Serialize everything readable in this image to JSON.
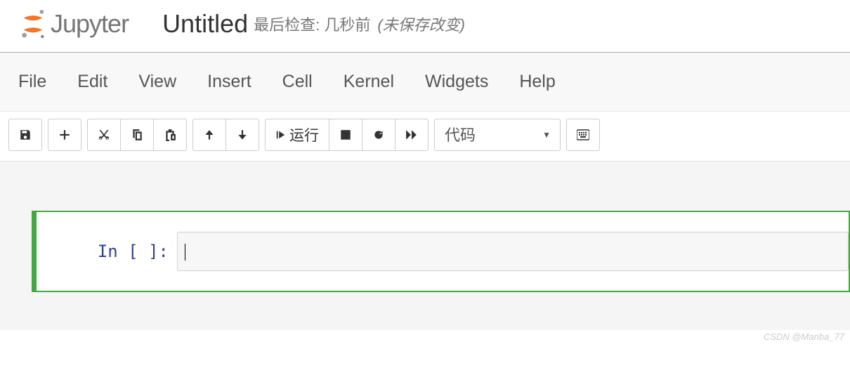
{
  "header": {
    "logo_text": "Jupyter",
    "title": "Untitled",
    "checkpoint": "最后检查: 几秒前",
    "autosave": "(未保存改变)"
  },
  "menu": {
    "items": [
      "File",
      "Edit",
      "View",
      "Insert",
      "Cell",
      "Kernel",
      "Widgets",
      "Help"
    ]
  },
  "toolbar": {
    "run_label": "运行",
    "cell_type": "代码"
  },
  "cell": {
    "prompt": "In [ ]:",
    "content": ""
  },
  "watermark": "CSDN @Manba_77"
}
